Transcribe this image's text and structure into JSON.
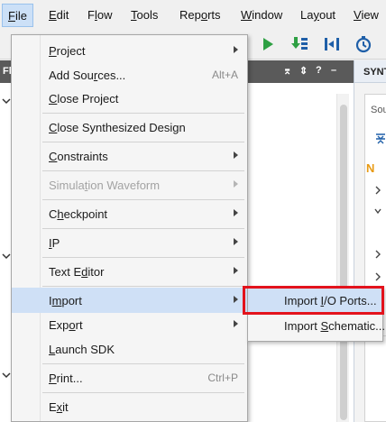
{
  "menubar": {
    "items": [
      {
        "pre": "",
        "mn": "F",
        "post": "ile"
      },
      {
        "pre": "",
        "mn": "E",
        "post": "dit"
      },
      {
        "pre": "F",
        "mn": "l",
        "post": "ow"
      },
      {
        "pre": "",
        "mn": "T",
        "post": "ools"
      },
      {
        "pre": "Rep",
        "mn": "o",
        "post": "rts"
      },
      {
        "pre": "",
        "mn": "W",
        "post": "indow"
      },
      {
        "pre": "La",
        "mn": "y",
        "post": "out"
      },
      {
        "pre": "",
        "mn": "V",
        "post": "iew"
      }
    ]
  },
  "toolbar": {
    "icons": [
      "run-icon",
      "run-implementation-icon",
      "step-icon",
      "timer-icon"
    ]
  },
  "left_panel": {
    "header_label": "Fl",
    "header_icons": [
      "⌆",
      "⇕",
      "?",
      "–"
    ]
  },
  "right_panel": {
    "header_label": "SYNT",
    "section_label": "Sou",
    "n_label": "N"
  },
  "file_menu": {
    "items": [
      {
        "pre": "",
        "mn": "P",
        "post": "roject",
        "shortcut": "",
        "submenu": true,
        "disabled": false
      },
      {
        "pre": "Add Sou",
        "mn": "r",
        "post": "ces...",
        "shortcut": "Alt+A",
        "submenu": false,
        "disabled": false
      },
      {
        "pre": "",
        "mn": "C",
        "post": "lose Project",
        "shortcut": "",
        "submenu": false,
        "disabled": false
      },
      {
        "pre": "",
        "mn": "C",
        "post": "lose Synthesized Design",
        "shortcut": "",
        "submenu": false,
        "disabled": false
      },
      {
        "pre": "",
        "mn": "C",
        "post": "onstraints",
        "shortcut": "",
        "submenu": true,
        "disabled": false
      },
      {
        "pre": "Simula",
        "mn": "t",
        "post": "ion Waveform",
        "shortcut": "",
        "submenu": true,
        "disabled": true
      },
      {
        "pre": "C",
        "mn": "h",
        "post": "eckpoint",
        "shortcut": "",
        "submenu": true,
        "disabled": false
      },
      {
        "pre": "",
        "mn": "I",
        "post": "P",
        "shortcut": "",
        "submenu": true,
        "disabled": false
      },
      {
        "pre": "Text E",
        "mn": "d",
        "post": "itor",
        "shortcut": "",
        "submenu": true,
        "disabled": false
      },
      {
        "pre": "I",
        "mn": "m",
        "post": "port",
        "shortcut": "",
        "submenu": true,
        "disabled": false
      },
      {
        "pre": "Exp",
        "mn": "o",
        "post": "rt",
        "shortcut": "",
        "submenu": true,
        "disabled": false
      },
      {
        "pre": "",
        "mn": "L",
        "post": "aunch SDK",
        "shortcut": "",
        "submenu": false,
        "disabled": false
      },
      {
        "pre": "",
        "mn": "P",
        "post": "rint...",
        "shortcut": "Ctrl+P",
        "submenu": false,
        "disabled": false
      },
      {
        "pre": "E",
        "mn": "x",
        "post": "it",
        "shortcut": "",
        "submenu": false,
        "disabled": false
      }
    ]
  },
  "import_submenu": {
    "items": [
      {
        "pre": "Import ",
        "mn": "I",
        "post": "/O Ports..."
      },
      {
        "pre": "Import ",
        "mn": "S",
        "post": "chematic..."
      }
    ]
  },
  "colors": {
    "highlight": "#cfe0f6",
    "callout_border": "#e3131c",
    "panel_header": "#5a5a5a",
    "run_green": "#2ea043",
    "toolbar_blue": "#1f5fa8"
  }
}
